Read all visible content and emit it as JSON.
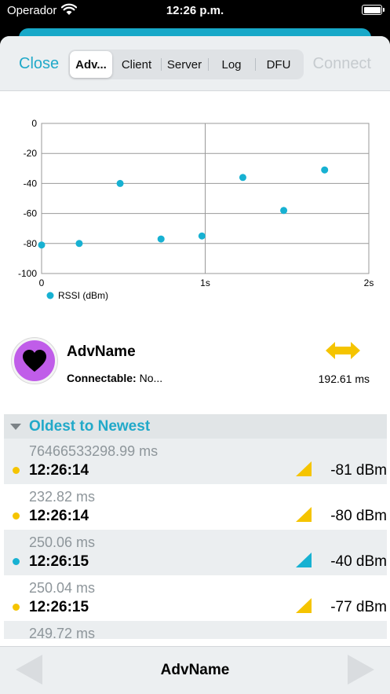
{
  "status_bar": {
    "carrier": "Operador",
    "time": "12:26 p.m."
  },
  "nav": {
    "close_label": "Close",
    "connect_label": "Connect",
    "tabs": [
      {
        "label": "Adv...",
        "active": true
      },
      {
        "label": "Client",
        "active": false
      },
      {
        "label": "Server",
        "active": false
      },
      {
        "label": "Log",
        "active": false
      },
      {
        "label": "DFU",
        "active": false
      }
    ]
  },
  "chart_data": {
    "type": "scatter",
    "x_tick_labels": [
      "0",
      "1s",
      "2s"
    ],
    "y_tick_labels": [
      "0",
      "-20",
      "-40",
      "-60",
      "-80",
      "-100"
    ],
    "xlim": [
      0,
      2
    ],
    "ylim": [
      -100,
      0
    ],
    "grid": true,
    "legend_position": "bottom-left",
    "series": [
      {
        "name": "RSSI (dBm)",
        "color": "#17b1d2",
        "points": [
          {
            "x": 0.0,
            "y": -81
          },
          {
            "x": 0.23,
            "y": -80
          },
          {
            "x": 0.48,
            "y": -40
          },
          {
            "x": 0.73,
            "y": -77
          },
          {
            "x": 0.98,
            "y": -75
          },
          {
            "x": 1.23,
            "y": -36
          },
          {
            "x": 1.48,
            "y": -58
          },
          {
            "x": 1.73,
            "y": -31
          }
        ]
      }
    ]
  },
  "device": {
    "name": "AdvName",
    "connectable_label": "Connectable:",
    "connectable_value": "No...",
    "interval": "192.61 ms",
    "avatar_color": "#c05de9",
    "interval_icon_color": "#f5c400"
  },
  "list": {
    "header": "Oldest to Newest",
    "rows": [
      {
        "delta": "76466533298.99 ms",
        "time": "12:26:14",
        "rssi": "-81 dBm",
        "color": "#f5c400"
      },
      {
        "delta": "232.82 ms",
        "time": "12:26:14",
        "rssi": "-80 dBm",
        "color": "#f5c400"
      },
      {
        "delta": "250.06 ms",
        "time": "12:26:15",
        "rssi": "-40 dBm",
        "color": "#17b1d2"
      },
      {
        "delta": "250.04 ms",
        "time": "12:26:15",
        "rssi": "-77 dBm",
        "color": "#f5c400"
      },
      {
        "delta": "249.72 ms",
        "time": "",
        "rssi": "",
        "color": ""
      }
    ]
  },
  "bottom_bar": {
    "title": "AdvName"
  }
}
